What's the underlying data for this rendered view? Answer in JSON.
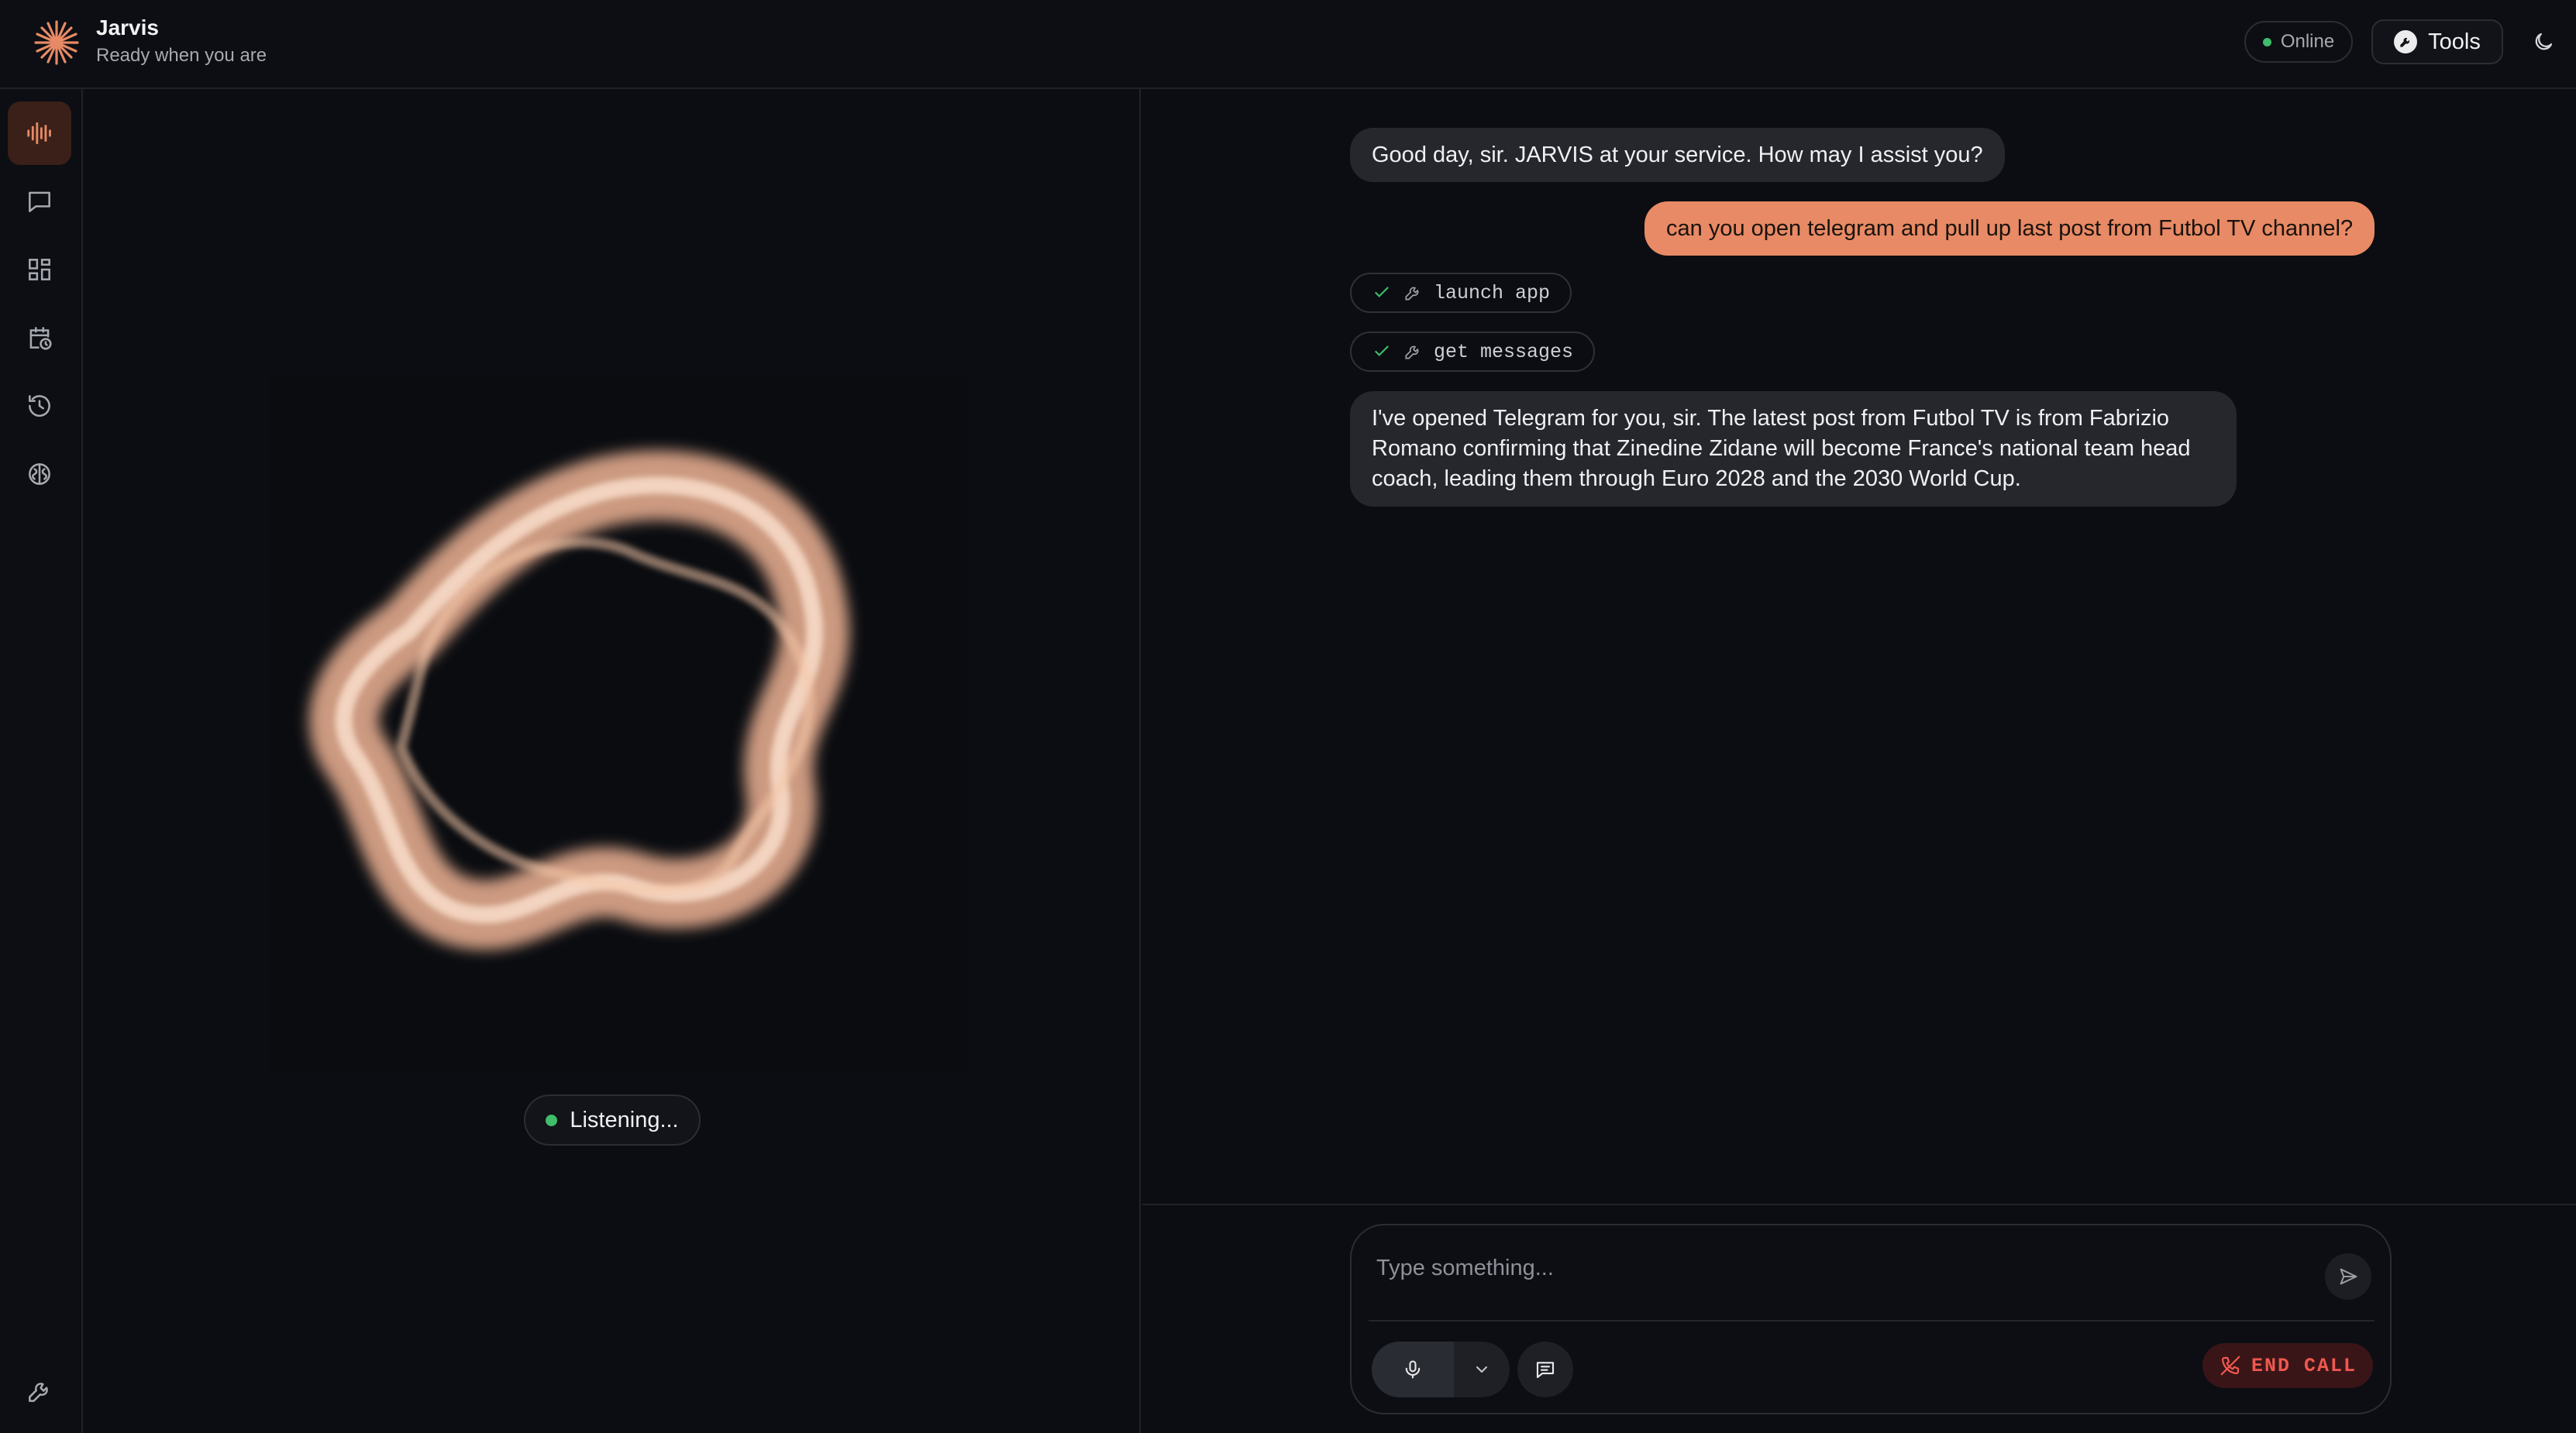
{
  "header": {
    "title": "Jarvis",
    "subtitle": "Ready when you are",
    "status": "Online",
    "tools_label": "Tools",
    "logo_icon": "sparkle-burst-icon",
    "theme_icon": "moon-icon"
  },
  "sidebar": {
    "items": [
      {
        "icon": "voice-wave-icon",
        "active": true
      },
      {
        "icon": "chat-bubble-icon",
        "active": false
      },
      {
        "icon": "dashboard-grid-icon",
        "active": false
      },
      {
        "icon": "calendar-clock-icon",
        "active": false
      },
      {
        "icon": "history-icon",
        "active": false
      },
      {
        "icon": "brain-icon",
        "active": false
      }
    ],
    "footer_icon": "wrench-icon"
  },
  "visualizer": {
    "status": "Listening..."
  },
  "chat": {
    "messages": [
      {
        "role": "assistant",
        "text": "Good day, sir. JARVIS at your service. How may I assist you?"
      },
      {
        "role": "user",
        "text": "can you open telegram and pull up last post from Futbol TV channel?"
      },
      {
        "role": "tool",
        "text": "launch app",
        "status": "done"
      },
      {
        "role": "tool",
        "text": "get messages",
        "status": "done"
      },
      {
        "role": "assistant",
        "text": "I've opened Telegram for you, sir. The latest post from Futbol TV is from Fabrizio Romano confirming that Zinedine Zidane will become France's national team head coach, leading them through Euro 2028 and the 2030 World Cup."
      }
    ]
  },
  "composer": {
    "placeholder": "Type something...",
    "end_call_label": "END CALL"
  },
  "colors": {
    "accent": "#e78a65",
    "online": "#3fbd6a",
    "danger": "#f0584f",
    "background": "#0b0d12"
  }
}
